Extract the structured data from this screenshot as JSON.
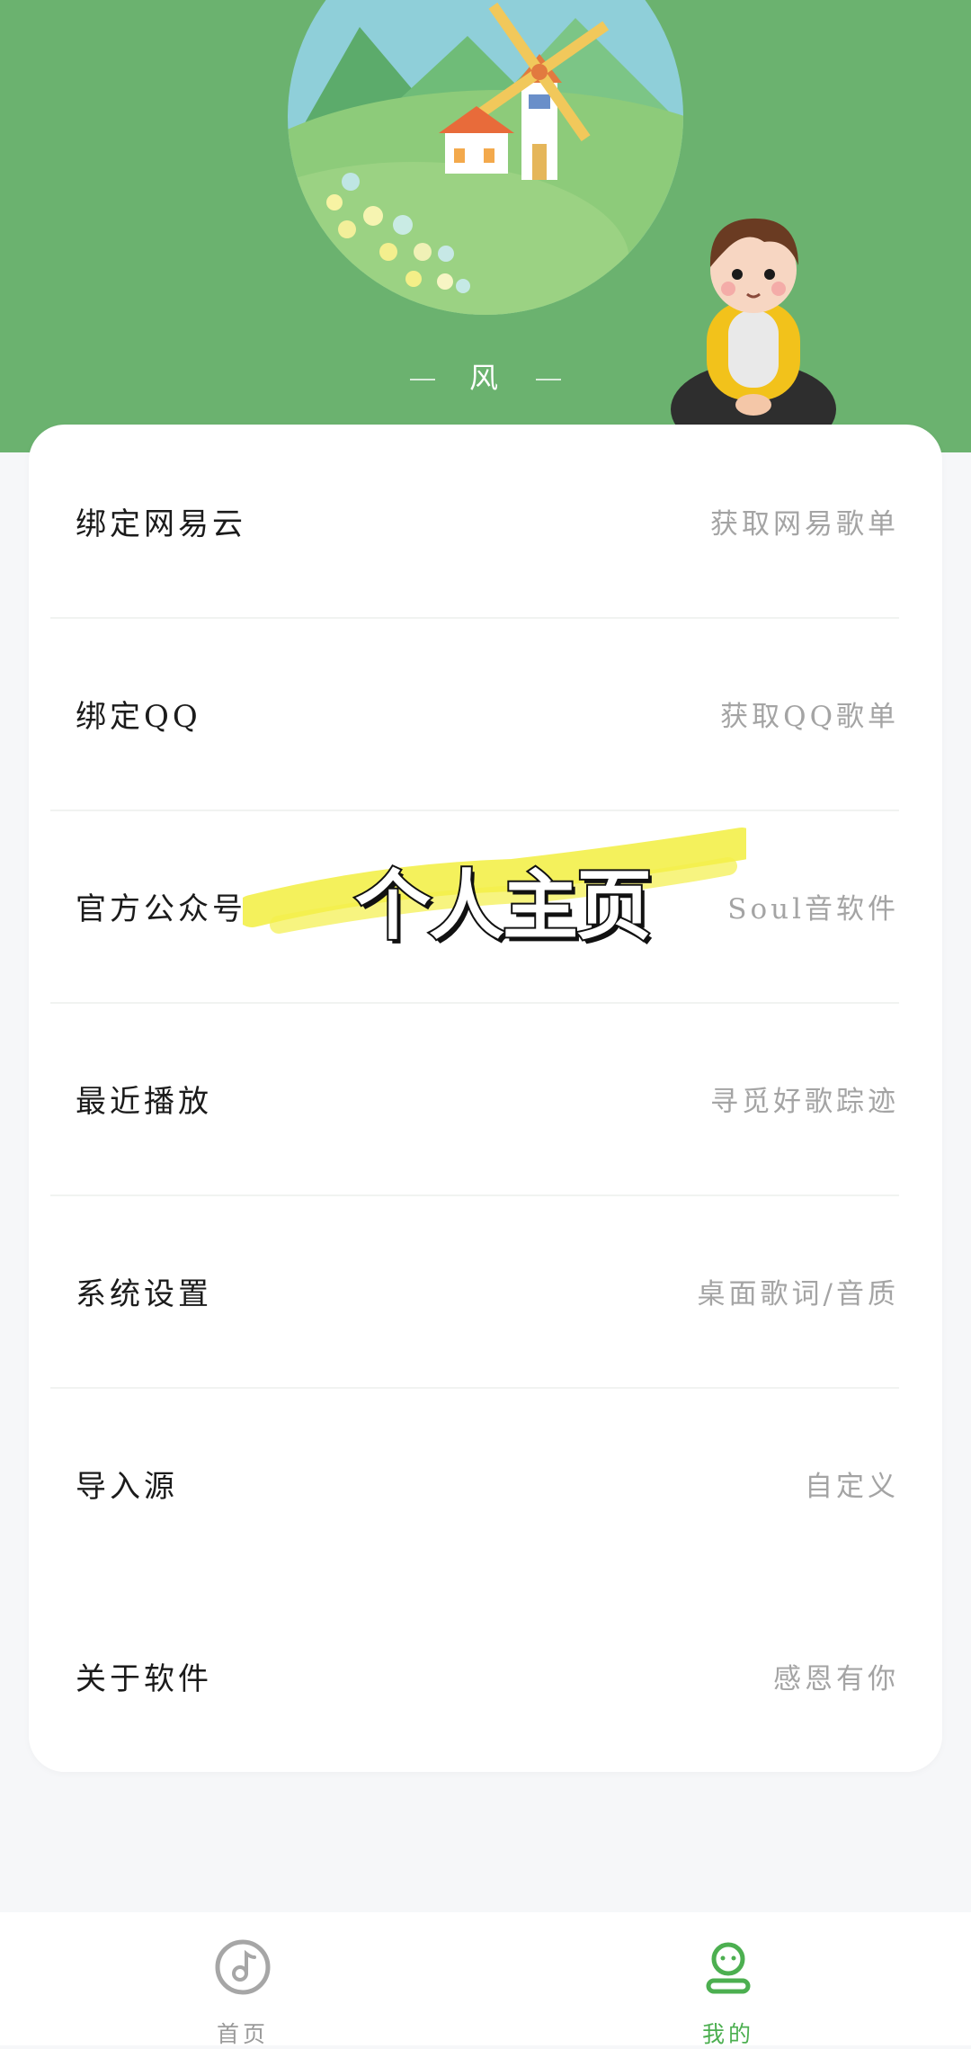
{
  "profile": {
    "username": "风"
  },
  "menu": [
    {
      "label": "绑定网易云",
      "hint": "获取网易歌单"
    },
    {
      "label": "绑定QQ",
      "hint": "获取QQ歌单"
    },
    {
      "label": "官方公众号",
      "hint": "Soul音软件"
    },
    {
      "label": "最近播放",
      "hint": "寻觅好歌踪迹"
    },
    {
      "label": "系统设置",
      "hint": "桌面歌词/音质"
    },
    {
      "label": "导入源",
      "hint": "自定义"
    },
    {
      "label": "关于软件",
      "hint": "感恩有你"
    }
  ],
  "overlay": {
    "title": "个人主页"
  },
  "tabbar": {
    "home": {
      "label": "首页",
      "icon": "music-note-icon",
      "color": "#9a9a9a"
    },
    "mine": {
      "label": "我的",
      "icon": "user-icon",
      "color": "#4caf50"
    }
  },
  "colors": {
    "header": "#6bb26f",
    "accent": "#4caf50",
    "highlight": "#f3f04a"
  }
}
